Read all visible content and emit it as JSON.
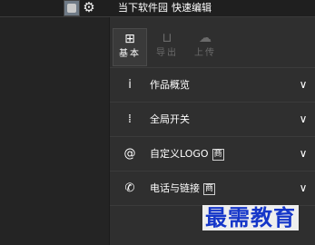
{
  "header": {
    "title_left": "当下软件园",
    "title_right": "快速编辑"
  },
  "tabs": [
    {
      "label": "基本",
      "icon": "basic-icon"
    },
    {
      "label": "导出",
      "icon": "export-icon"
    },
    {
      "label": "上传",
      "icon": "upload-icon"
    }
  ],
  "rows": [
    {
      "label": "作品概览",
      "icon": "info-icon",
      "icon_glyph": "i",
      "badge": ""
    },
    {
      "label": "全局开关",
      "icon": "sliders-icon",
      "icon_glyph": "⁞",
      "badge": ""
    },
    {
      "label": "自定义LOGO",
      "icon": "logo-icon",
      "icon_glyph": "@",
      "badge": "商"
    },
    {
      "label": "电话与链接",
      "icon": "phone-icon",
      "icon_glyph": "✆",
      "badge": "商"
    }
  ],
  "watermark": "最需教育",
  "colors": {
    "background": "#2b2b2b",
    "panel": "#2f2f2f",
    "watermark": "#1536c9"
  }
}
